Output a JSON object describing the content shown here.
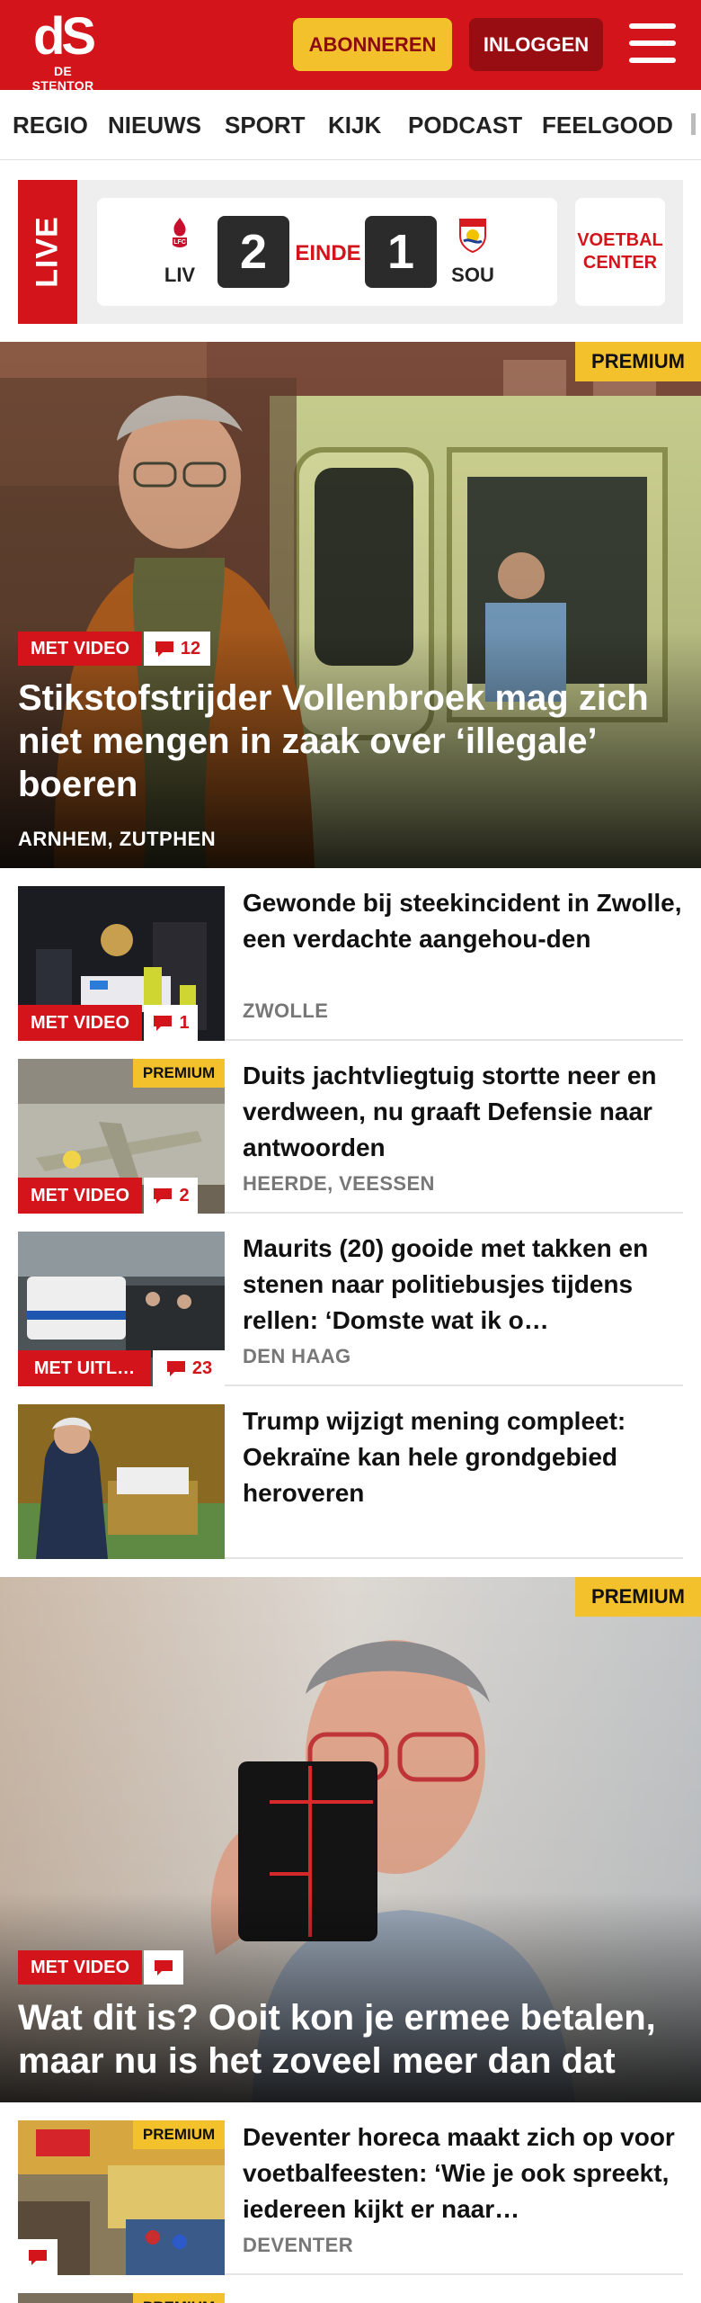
{
  "header": {
    "logo_text": "dS",
    "logo_subtitle": "DE STENTOR",
    "subscribe_label": "ABONNEREN",
    "login_label": "INLOGGEN",
    "brand_color": "#d3141b"
  },
  "nav": {
    "items": [
      "REGIO",
      "NIEUWS",
      "SPORT",
      "KIJK",
      "PODCAST",
      "FEELGOOD"
    ]
  },
  "live": {
    "label": "LIVE",
    "home_team": "LIV",
    "home_score": "2",
    "status": "EINDE",
    "away_score": "1",
    "away_team": "SOU",
    "voetbal_center": "VOETBAL CENTER"
  },
  "hero1": {
    "badge": "PREMIUM",
    "video_tag": "MET VIDEO",
    "comments": "12",
    "title": "Stikstofstrijder Vollenbroek mag zich niet mengen in zaak over ‘illegale’ boeren",
    "location": "ARNHEM, ZUTPHEN"
  },
  "articles": [
    {
      "title": "Gewonde bij steekincident in Zwolle, een verdachte aangehou-den",
      "location": "ZWOLLE",
      "video_tag": "MET VIDEO",
      "comments": "1",
      "badge": ""
    },
    {
      "title": "Duits jachtvliegtuig stortte neer en verdween, nu graaft Defensie naar antwoorden",
      "location": "HEERDE, VEESSEN",
      "video_tag": "MET VIDEO",
      "comments": "2",
      "badge": "PREMIUM"
    },
    {
      "title": "Maurits (20) gooide met takken en stenen naar politiebusjes tijdens rellen: ‘Domste wat ik o…",
      "location": "DEN HAAG",
      "video_tag": "MET UITL…",
      "comments": "23",
      "badge": ""
    },
    {
      "title": "Trump wijzigt mening compleet: Oekraïne kan hele grondgebied heroveren",
      "location": "",
      "video_tag": "",
      "comments": "",
      "badge": ""
    }
  ],
  "hero2": {
    "badge": "PREMIUM",
    "video_tag": "MET VIDEO",
    "title": "Wat dit is? Ooit kon je ermee betalen, maar nu is het zoveel meer dan dat"
  },
  "article_bottom": {
    "title": "Deventer horeca maakt zich op voor voetbalfeesten: ‘Wie je ook spreekt, iedereen kijkt er naar…",
    "location": "DEVENTER",
    "badge": "PREMIUM",
    "next_badge": "PREMIUM"
  }
}
